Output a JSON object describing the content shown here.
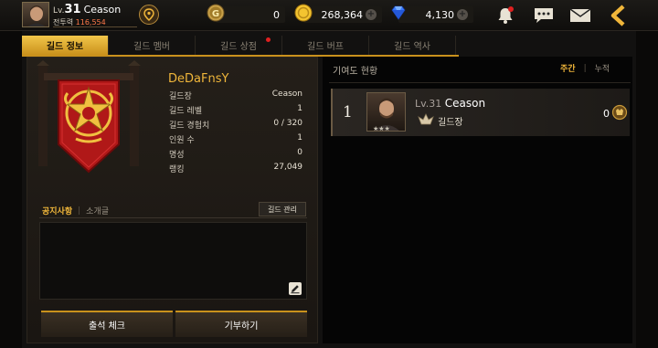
{
  "header": {
    "level_prefix": "Lv.",
    "level": "31",
    "player_name": "Ceason",
    "power_label": "전투력",
    "power_value": "116,554",
    "gold_coin_value": "0",
    "gold_value": "268,364",
    "gem_value": "4,130"
  },
  "tabs": [
    {
      "label": "길드 정보",
      "active": true
    },
    {
      "label": "길드 멤버",
      "active": false
    },
    {
      "label": "길드 상점",
      "active": false,
      "dot": true
    },
    {
      "label": "길드 버프",
      "active": false
    },
    {
      "label": "길드 역사",
      "active": false
    }
  ],
  "guild": {
    "name": "DeDaFnsY",
    "stats": [
      {
        "label": "길드장",
        "value": "Ceason"
      },
      {
        "label": "길드 레벨",
        "value": "1"
      },
      {
        "label": "길드 경험치",
        "value": "0 / 320"
      },
      {
        "label": "인원 수",
        "value": "1"
      },
      {
        "label": "명성",
        "value": "0"
      },
      {
        "label": "랭킹",
        "value": "27,049"
      }
    ]
  },
  "notice": {
    "tab_notice": "공지사항",
    "tab_intro": "소개글",
    "manage_button": "길드 관리",
    "text": ""
  },
  "buttons": {
    "attendance": "출석 체크",
    "donate": "기부하기"
  },
  "contribution": {
    "title": "기여도 현황",
    "toggle_weekly": "주간",
    "toggle_total": "누적",
    "members": [
      {
        "rank": "1",
        "level_prefix": "Lv.",
        "level": "31",
        "name": "Ceason",
        "role": "길드장",
        "score": "0"
      }
    ]
  },
  "colors": {
    "accent": "#f0b63a",
    "tab_active": "#e8b532",
    "banner_red": "#b01818",
    "notification_dot": "#e02020"
  }
}
